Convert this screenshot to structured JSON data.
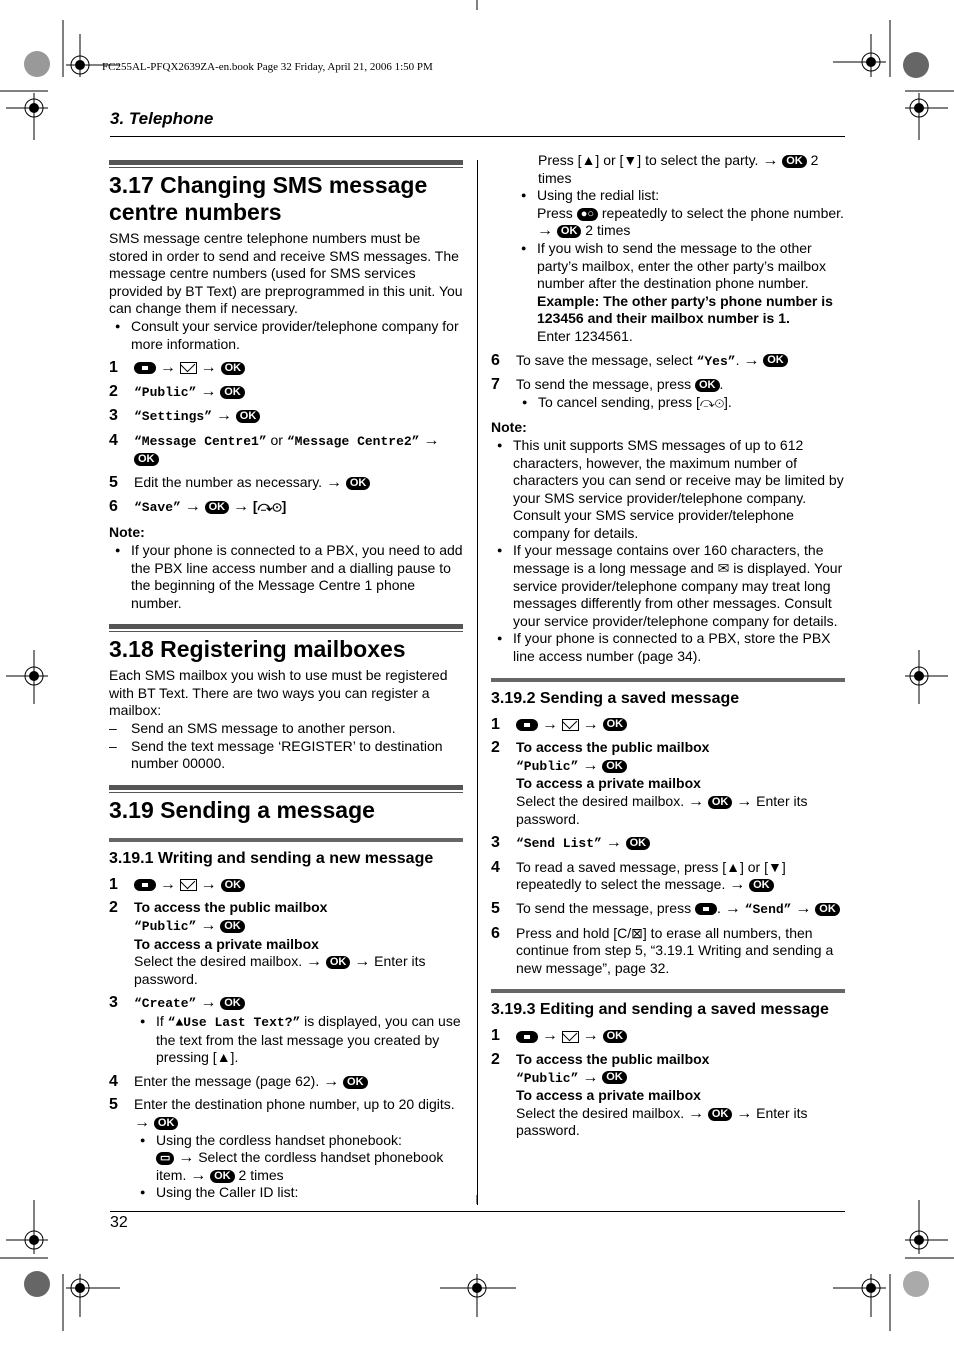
{
  "print_header": "FC255AL-PFQX2639ZA-en.book  Page 32  Friday, April 21, 2006  1:50 PM",
  "chapter": "3. Telephone",
  "page_number": "32",
  "icons": {
    "arrow": "→",
    "ok": "OK",
    "menu": "menu-key-icon",
    "envelope": "envelope-icon",
    "off": "[⤼⊙]",
    "up": "[▲]",
    "down": "[▼]",
    "clear": "[C/⊠]"
  },
  "s317": {
    "title": "3.17 Changing SMS message centre numbers",
    "intro": "SMS message centre telephone numbers must be stored in order to send and receive SMS messages. The message centre numbers (used for SMS services provided by BT Text) are preprogrammed in this unit. You can change them if necessary.",
    "bullet": "Consult your service provider/telephone company for more information.",
    "steps": {
      "s2_text": "“Public”",
      "s3_text": "“Settings”",
      "s4_a": "“Message Centre1”",
      "s4_or": " or ",
      "s4_b": "“Message Centre2”",
      "s5_text": "Edit the number as necessary.",
      "s6_text": "“Save”"
    },
    "note_label": "Note:",
    "note": "If your phone is connected to a PBX, you need to add the PBX line access number and a dialling pause to the beginning of the Message Centre 1 phone number."
  },
  "s318": {
    "title": "3.18 Registering mailboxes",
    "intro": "Each SMS mailbox you wish to use must be registered with BT Text. There are two ways you can register a mailbox:",
    "items": [
      "Send an SMS message to another person.",
      "Send the text message ‘REGISTER’ to destination number 00000."
    ]
  },
  "s319": {
    "title": "3.19 Sending a message",
    "sub1": {
      "title": "3.19.1 Writing and sending a new message",
      "public_label": "To access the public mailbox",
      "public_text": "“Public”",
      "private_label": "To access a private mailbox",
      "private_text": "Select the desired mailbox.",
      "enter_pw": "Enter its password.",
      "s3_text": "“Create”",
      "s3_bullet_a": "If ",
      "s3_bullet_mono": "“▲Use Last Text?”",
      "s3_bullet_b": " is displayed, you can use the text from the last message you created by pressing [▲].",
      "s4_text": "Enter the message (page 62).",
      "s5_text": "Enter the destination phone number, up to 20 digits.",
      "b_phonebook": "Using the cordless handset phonebook:",
      "b_phonebook_2": "Select the cordless handset phonebook item.",
      "two_times": "2 times",
      "b_callerid": "Using the Caller ID list:",
      "b_callerid_2a": "Press [▲] or [▼] to select the party.",
      "b_redial": "Using the redial list:",
      "b_redial_2a": "Press",
      "b_redial_2b": "repeatedly to select the phone number.",
      "b_mailbox": "If you wish to send the message to the other party’s mailbox, enter the other party’s mailbox number after the destination phone number.",
      "b_example": "Example: The other party’s phone number is 123456 and their mailbox number is 1.",
      "b_enter": "Enter 1234561.",
      "s6_text_a": "To save the message, select ",
      "s6_mono": "“Yes”",
      "s7_text": "To send the message, press",
      "s7_bullet": "To cancel sending, press [⤼⊙].",
      "note_label": "Note:",
      "notes": [
        "This unit supports SMS messages of up to 612 characters, however, the maximum number of characters you can send or receive may be limited by your SMS service provider/telephone company. Consult your SMS service provider/telephone company for details.",
        "If your message contains over 160 characters, the message is a long message and ✉ is displayed. Your service provider/telephone company may treat long messages differently from other messages. Consult your service provider/telephone company for details.",
        "If your phone is connected to a PBX, store the PBX line access number (page 34)."
      ]
    },
    "sub2": {
      "title": "3.19.2 Sending a saved message",
      "public_label": "To access the public mailbox",
      "public_text": "“Public”",
      "private_label": "To access a private mailbox",
      "private_text": "Select the desired mailbox.",
      "enter_pw": "Enter its password.",
      "s3_text": "“Send List”",
      "s4_text": "To read a saved message, press [▲] or [▼] repeatedly to select the message.",
      "s5_text_a": "To send the message, press",
      "s5_mono": "“Send”",
      "s6_text": "Press and hold [C/⊠] to erase all numbers, then continue from step 5, “3.19.1 Writing and sending a new message”, page 32."
    },
    "sub3": {
      "title": "3.19.3 Editing and sending a saved message",
      "public_label": "To access the public mailbox",
      "public_text": "“Public”",
      "private_label": "To access a private mailbox",
      "private_text": "Select the desired mailbox.",
      "enter_pw": "Enter its password."
    }
  }
}
